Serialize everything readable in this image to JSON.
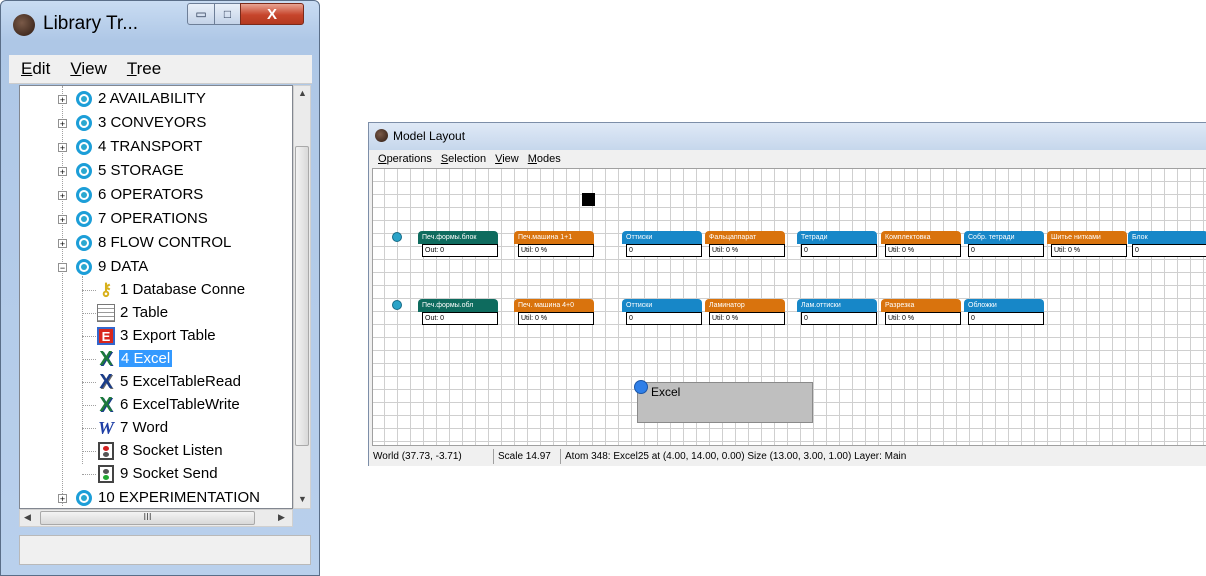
{
  "library_window": {
    "title": "Library Tr...",
    "buttons": {
      "minimize": "▭",
      "maximize": "□",
      "close": "X"
    },
    "menu": [
      {
        "key": "E",
        "rest": "dit"
      },
      {
        "key": "V",
        "rest": "iew"
      },
      {
        "key": "T",
        "rest": "ree"
      }
    ],
    "tree": {
      "groups_top": [
        "2 AVAILABILITY",
        "3 CONVEYORS",
        "4 TRANSPORT",
        "5 STORAGE",
        "6 OPERATORS",
        "7 OPERATIONS",
        "8 FLOW CONTROL",
        "9 DATA"
      ],
      "data_children": [
        {
          "label": "1 Database Conne",
          "icon": "database-key-icon"
        },
        {
          "label": "2 Table",
          "icon": "table-icon"
        },
        {
          "label": "3 Export Table",
          "icon": "export-table-icon"
        },
        {
          "label": "4 Excel",
          "icon": "excel-icon",
          "selected": true
        },
        {
          "label": "5 ExcelTableRead",
          "icon": "excel-icon"
        },
        {
          "label": "6 ExcelTableWrite",
          "icon": "excel-icon"
        },
        {
          "label": "7 Word",
          "icon": "word-icon"
        },
        {
          "label": "8 Socket Listen",
          "icon": "traffic-light-icon"
        },
        {
          "label": "9 Socket Send",
          "icon": "traffic-light-icon"
        }
      ],
      "group_bottom": "10 EXPERIMENTATION"
    },
    "hscroll_thumb": "III"
  },
  "model_layout": {
    "title": "Model Layout",
    "menu": [
      {
        "key": "O",
        "rest": "perations"
      },
      {
        "key": "S",
        "rest": "election"
      },
      {
        "key": "V",
        "rest": "iew"
      },
      {
        "key": "M",
        "rest": "odes"
      }
    ],
    "row1": [
      {
        "title": "Печ.формы.блок",
        "value": "Out: 0",
        "color": "#0e6b5e"
      },
      {
        "title": "Печ.машина 1+1",
        "value": "Util: 0 %",
        "color": "#d9730d"
      },
      {
        "title": "Оттиски",
        "value": "0",
        "color": "#1787c8"
      },
      {
        "title": "Фальцаппарат",
        "value": "Util: 0 %",
        "color": "#d9730d"
      },
      {
        "title": "Тетради",
        "value": "0",
        "color": "#1787c8"
      },
      {
        "title": "Комплектовка",
        "value": "Util: 0 %",
        "color": "#d9730d"
      },
      {
        "title": "Собр. тетради",
        "value": "0",
        "color": "#1787c8"
      },
      {
        "title": "Шитье нитками",
        "value": "Util: 0 %",
        "color": "#d9730d"
      },
      {
        "title": "Блок",
        "value": "0",
        "color": "#1787c8"
      }
    ],
    "row2": [
      {
        "title": "Печ.формы.обл",
        "value": "Out: 0",
        "color": "#0e6b5e"
      },
      {
        "title": "Печ. машина 4+0",
        "value": "Util: 0 %",
        "color": "#d9730d"
      },
      {
        "title": "Оттиски",
        "value": "0",
        "color": "#1787c8"
      },
      {
        "title": "Ламинатор",
        "value": "Util: 0 %",
        "color": "#d9730d"
      },
      {
        "title": "Лам.оттиски",
        "value": "0",
        "color": "#1787c8"
      },
      {
        "title": "Разрезка",
        "value": "Util: 0 %",
        "color": "#d9730d"
      },
      {
        "title": "Обложки",
        "value": "0",
        "color": "#1787c8"
      }
    ],
    "excel_atom_label": "Excel",
    "status": {
      "world": "World (37.73, -3.71)",
      "scale": "Scale 14.97",
      "atom": "Atom 348: Excel25 at (4.00, 14.00, 0.00) Size (13.00, 3.00, 1.00) Layer: Main"
    }
  }
}
